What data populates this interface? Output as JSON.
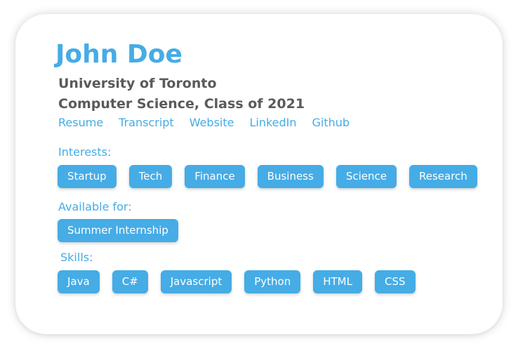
{
  "profile": {
    "name": "John Doe",
    "university": "University of Toronto",
    "program": "Computer Science, Class of 2021",
    "links": [
      "Resume",
      "Transcript",
      "Website",
      "LinkedIn",
      "Github"
    ]
  },
  "interests": {
    "label": "Interests:",
    "items": [
      "Startup",
      "Tech",
      "Finance",
      "Business",
      "Science",
      "Research"
    ]
  },
  "available": {
    "label": "Available for:",
    "items": [
      "Summer Internship"
    ]
  },
  "skills": {
    "label": "Skills:",
    "items": [
      "Java",
      "C#",
      "Javascript",
      "Python",
      "HTML",
      "CSS"
    ]
  },
  "colors": {
    "accent": "#45ace6",
    "text": "#5a5a5a",
    "chip_text": "#ffffff"
  }
}
